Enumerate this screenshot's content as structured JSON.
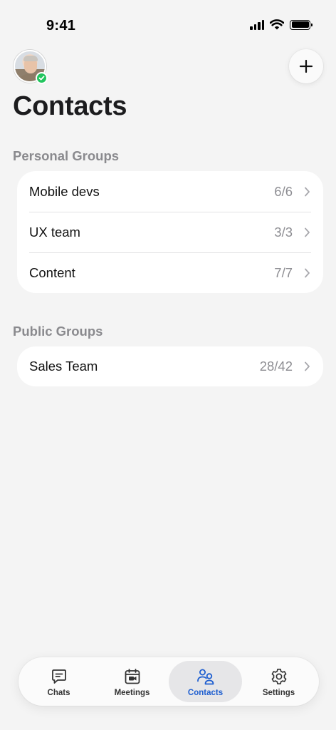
{
  "status_bar": {
    "time": "9:41"
  },
  "header": {
    "title": "Contacts"
  },
  "personal_groups": {
    "label": "Personal Groups",
    "items": [
      {
        "name": "Mobile devs",
        "count": "6/6"
      },
      {
        "name": "UX team",
        "count": "3/3"
      },
      {
        "name": "Content",
        "count": "7/7"
      }
    ]
  },
  "public_groups": {
    "label": "Public Groups",
    "items": [
      {
        "name": "Sales Team",
        "count": "28/42"
      }
    ]
  },
  "tab_bar": {
    "tabs": [
      {
        "label": "Chats",
        "icon": "chat-icon"
      },
      {
        "label": "Meetings",
        "icon": "calendar-video-icon"
      },
      {
        "label": "Contacts",
        "icon": "people-icon",
        "active": true
      },
      {
        "label": "Settings",
        "icon": "gear-icon"
      }
    ]
  },
  "colors": {
    "accent": "#1f5fd0",
    "online": "#22c55e",
    "background": "#f4f4f4"
  }
}
